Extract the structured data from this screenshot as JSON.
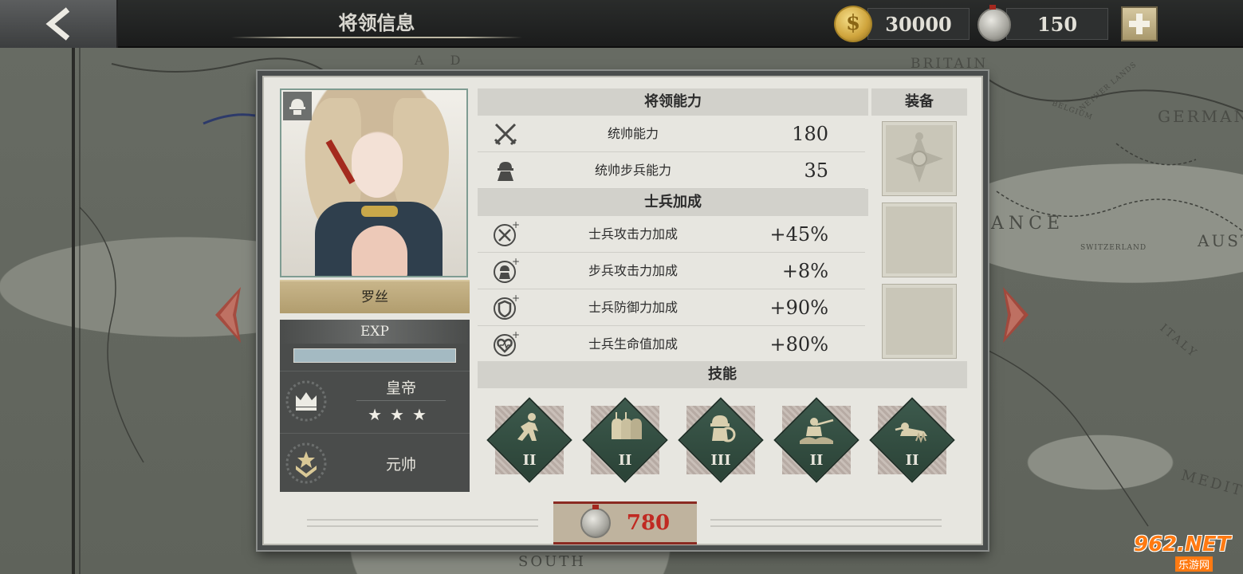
{
  "header": {
    "title": "将领信息",
    "gold": "30000",
    "medals": "150",
    "gold_symbol": "$"
  },
  "map": {
    "labels": [
      "BRITAIN",
      "GERMANY",
      "ANCE",
      "AUST",
      "SWITZERLAND",
      "ITALY",
      "MEDITER",
      "SOUTH",
      "NETHER LANDS",
      "BELGIUM",
      "A D"
    ]
  },
  "general": {
    "name": "罗丝",
    "exp_label": "EXP",
    "exp_progress": 1.0,
    "title": "皇帝",
    "stars": "★★★",
    "rank": "元帅"
  },
  "sections": {
    "command": "将领能力",
    "soldier_bonus": "士兵加成",
    "equipment": "装备",
    "skills": "技能"
  },
  "command_stats": [
    {
      "label": "统帅能力",
      "value": "180",
      "icon": "crossed-swords-icon"
    },
    {
      "label": "统帅步兵能力",
      "value": "35",
      "icon": "infantry-icon"
    }
  ],
  "bonus_stats": [
    {
      "label": "士兵攻击力加成",
      "value": "+45%",
      "icon": "attack-bonus-icon"
    },
    {
      "label": "步兵攻击力加成",
      "value": "+8%",
      "icon": "infantry-attack-bonus-icon"
    },
    {
      "label": "士兵防御力加成",
      "value": "+90%",
      "icon": "defense-bonus-icon"
    },
    {
      "label": "士兵生命值加成",
      "value": "+80%",
      "icon": "health-bonus-icon"
    }
  ],
  "skills": [
    {
      "level": "II",
      "icon": "charge-skill-icon"
    },
    {
      "level": "II",
      "icon": "formation-skill-icon"
    },
    {
      "level": "III",
      "icon": "shield-skill-icon"
    },
    {
      "level": "II",
      "icon": "rifleman-skill-icon"
    },
    {
      "level": "II",
      "icon": "crawl-skill-icon"
    }
  ],
  "cost": {
    "value": "780"
  },
  "watermark": {
    "logo": "962.NET",
    "sub": "乐游网"
  },
  "colors": {
    "accent_red": "#c02a22",
    "panel_bg": "#e7e6e0",
    "skill_green": "#2f4a3e",
    "name_gold": "#c8b58a"
  }
}
